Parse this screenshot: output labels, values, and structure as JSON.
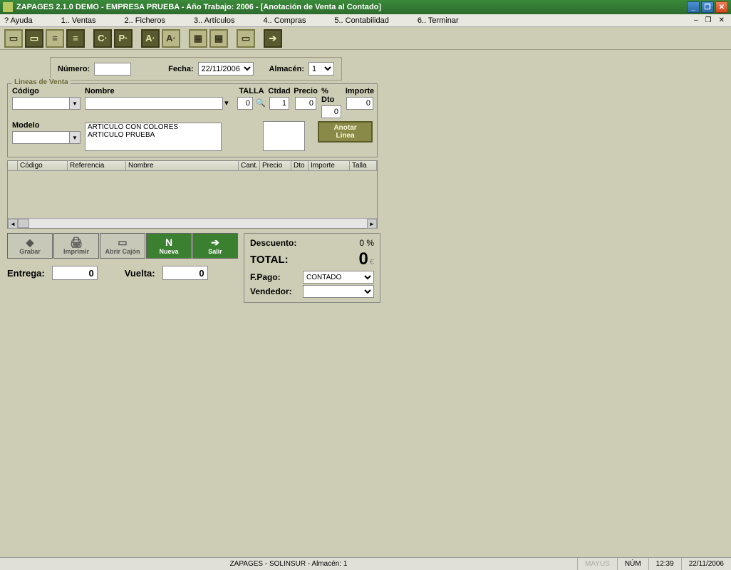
{
  "title": "ZAPAGES 2.1.0  DEMO     -     EMPRESA PRUEBA  -   Año Trabajo: 2006 - [Anotación de Venta al Contado]",
  "menu": {
    "ayuda": "? Ayuda",
    "ventas": "1.. Ventas",
    "ficheros": "2.. Ficheros",
    "articulos": "3.. Artículos",
    "compras": "4.. Compras",
    "contabilidad": "5.. Contabilidad",
    "terminar": "6.. Terminar"
  },
  "form": {
    "numero_lbl": "Número:",
    "numero_val": "",
    "fecha_lbl": "Fecha:",
    "fecha_val": "22/11/2006",
    "almacen_lbl": "Almacén:",
    "almacen_val": "1"
  },
  "lines": {
    "legend": "Lineas de Venta",
    "codigo_lbl": "Código",
    "nombre_lbl": "Nombre",
    "talla_lbl": "TALLA",
    "ctdad_lbl": "Ctdad",
    "precio_lbl": "Precio",
    "pdto_lbl": "% Dto",
    "importe_lbl": "Importe",
    "modelo_lbl": "Modelo",
    "talla_val": "0",
    "ctdad_val": "1",
    "precio_val": "0",
    "pdto_val": "0",
    "importe_val": "0",
    "list": [
      "ARTICULO CON COLORES",
      "ARTICULO PRUEBA"
    ],
    "anotar1": "Anotar",
    "anotar2": "Linea"
  },
  "table": {
    "cols": [
      "Código",
      "Referencia",
      "Nombre",
      "Cant.",
      "Precio",
      "Dto",
      "Importe",
      "Talla"
    ]
  },
  "actions": {
    "grabar": "Grabar",
    "imprimir": "Imprimir",
    "abrir": "Abrir Cajón",
    "nueva": "Nueva",
    "salir": "Salir"
  },
  "totals": {
    "descuento_lbl": "Descuento:",
    "descuento_val": "0 %",
    "total_lbl": "TOTAL:",
    "total_val": "0",
    "fpago_lbl": "F.Pago:",
    "fpago_val": "CONTADO",
    "vendedor_lbl": "Vendedor:",
    "vendedor_val": ""
  },
  "entrega": {
    "entrega_lbl": "Entrega:",
    "entrega_val": "0",
    "vuelta_lbl": "Vuelta:",
    "vuelta_val": "0"
  },
  "status": {
    "center": "ZAPAGES  -  SOLINSUR  -  Almacén: 1",
    "mayus": "MAYUS",
    "num": "NÚM",
    "time": "12:39",
    "date": "22/11/2006"
  }
}
